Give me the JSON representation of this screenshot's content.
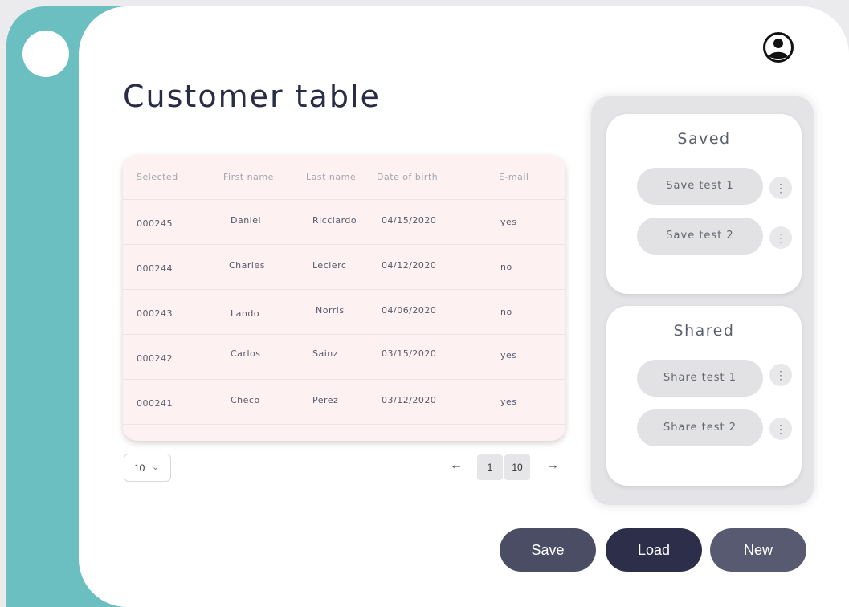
{
  "page": {
    "title": "Customer table"
  },
  "table": {
    "columns": [
      "Selected",
      "First name",
      "Last name",
      "Date of birth",
      "E-mail"
    ],
    "rows": [
      [
        "000245",
        "Daniel",
        "Ricciardo",
        "04/15/2020",
        "yes"
      ],
      [
        "000244",
        "Charles",
        "Leclerc",
        "04/12/2020",
        "no"
      ],
      [
        "000243",
        "Lando",
        "Norris",
        "04/06/2020",
        "no"
      ],
      [
        "000242",
        "Carlos",
        "Sainz",
        "03/15/2020",
        "yes"
      ],
      [
        "000241",
        "Checo",
        "Perez",
        "03/12/2020",
        "yes"
      ]
    ]
  },
  "pagination": {
    "page_size": "10",
    "prev_label": "←",
    "next_label": "→",
    "pages": [
      "1",
      "10"
    ]
  },
  "saved": {
    "title": "Saved",
    "items": [
      "Save test 1",
      "Save test 2"
    ]
  },
  "shared": {
    "title": "Shared",
    "items": [
      "Share test 1",
      "Share test 2"
    ]
  },
  "icons": {
    "more": "⋮",
    "chevron": "⌄"
  },
  "actions": {
    "save": "Save",
    "load": "Load",
    "new": "New"
  },
  "colors": {
    "accent_teal": "#6bbfc0",
    "save_button": "#4a4d63",
    "load_button": "#2c2e4a",
    "new_button": "#575a70"
  }
}
